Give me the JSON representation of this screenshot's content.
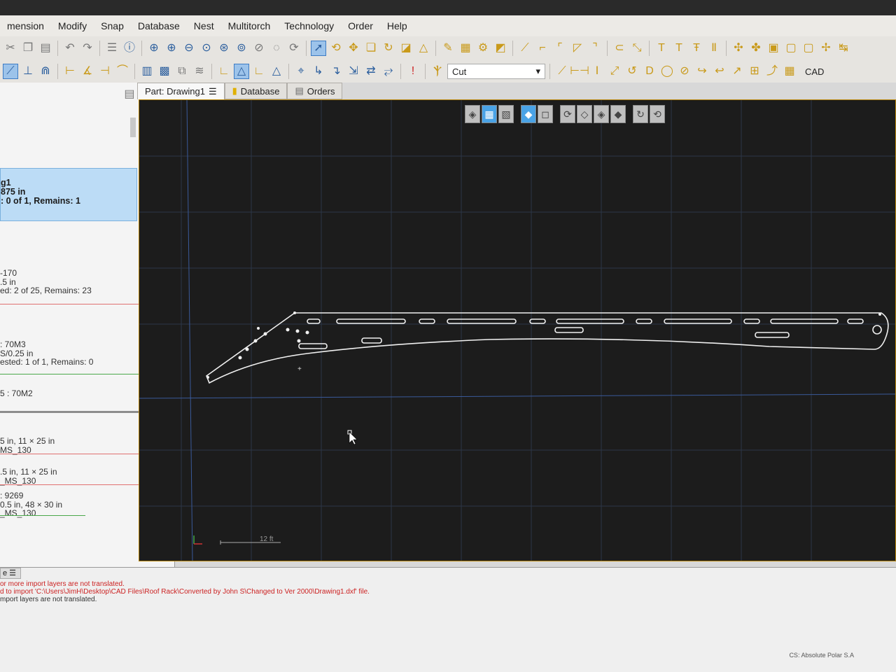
{
  "menu": [
    "mension",
    "Modify",
    "Snap",
    "Database",
    "Nest",
    "Multitorch",
    "Technology",
    "Order",
    "Help"
  ],
  "toolbar": {
    "cut_label": "Cut",
    "cad_label": "CAD"
  },
  "tabs": [
    {
      "label": "Part: Drawing1"
    },
    {
      "label": "Database"
    },
    {
      "label": "Orders"
    }
  ],
  "left_panel": {
    "selected_card": {
      "line1": "g1",
      "line2": "875 in",
      "line3": ": 0 of 1, Remains: 1"
    },
    "items": [
      {
        "line1": "-170",
        "line2": ".5 in",
        "line3": "ed: 2 of 25, Remains: 23",
        "color": "#e07070"
      },
      {
        "line1": ": 70M3",
        "line2": "S/0.25 in",
        "line3": "ested: 1 of 1, Remains: 0",
        "color": "#4aa84a"
      },
      {
        "line1": "5 : 70M2"
      }
    ],
    "sheets": [
      {
        "line1": "5 in, 11 × 25 in",
        "line2": "MS_130",
        "color": "#e07070"
      },
      {
        "line1": ".5 in, 11 × 25 in",
        "line2": "_MS_130",
        "color": "#e07070"
      },
      {
        "line1": ": 9269",
        "line2": "0.5 in, 48 × 30 in",
        "line3": "_MS_130",
        "color": "#4aa84a"
      }
    ]
  },
  "canvas": {
    "scale_label": "12 ft",
    "colors": {
      "grid": "#2d3b4e",
      "part": "#f0f0f0",
      "axis": "#3a5a9a"
    }
  },
  "messages": [
    {
      "text": "or more import layers are not translated.",
      "color": "#c22"
    },
    {
      "text": "d to import 'C:\\Users\\JimH\\Desktop\\CAD Files\\Roof Rack\\Converted by John S\\Changed to Ver 2000\\Drawing1.dxf' file.",
      "color": "#c22"
    },
    {
      "text": "mport layers are not translated.",
      "color": "#333"
    }
  ],
  "status": {
    "cs_label": "CS: Absolute Polar S.A"
  }
}
